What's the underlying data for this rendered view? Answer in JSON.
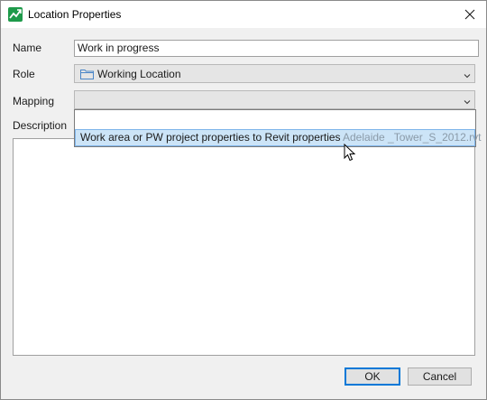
{
  "window": {
    "title": "Location Properties",
    "app_icon": "location-properties-app-icon",
    "close_icon": "close-icon"
  },
  "form": {
    "name_label": "Name",
    "name_value": "Work in progress",
    "role_label": "Role",
    "role_value": "Working Location",
    "role_icon": "folder-icon",
    "mapping_label": "Mapping",
    "mapping_value": "",
    "description_label": "Description",
    "description_value": ""
  },
  "mapping_dropdown": {
    "options": [
      {
        "label": "",
        "detail": ""
      },
      {
        "label": "Work area or PW project properties to Revit properties",
        "detail": "Adelaide _Tower_S_2012.rvt",
        "highlighted": true
      }
    ]
  },
  "buttons": {
    "ok": "OK",
    "cancel": "Cancel"
  },
  "colors": {
    "highlight_bg": "#cce4f7",
    "highlight_border": "#7eb4ea",
    "default_button_border": "#0078d7",
    "app_icon_green": "#1e9a4a"
  }
}
